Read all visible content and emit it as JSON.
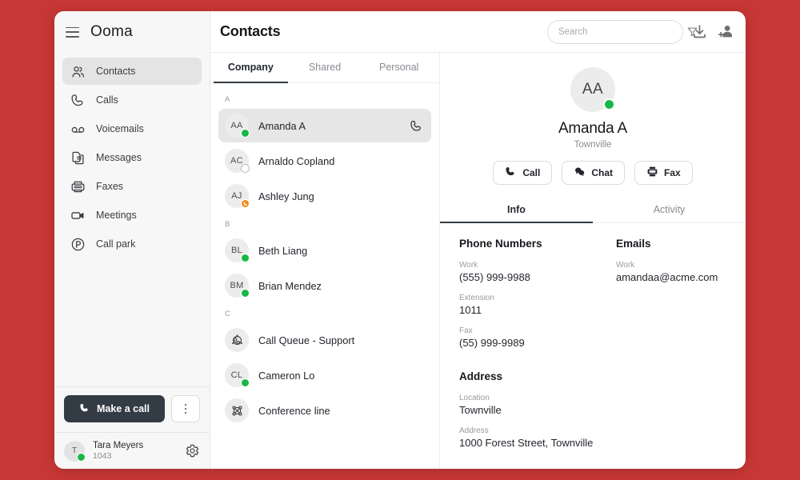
{
  "theme": {
    "desktop_bg": "#c73735",
    "accent_dark": "#333b44",
    "status_online": "#18b845",
    "status_oncall": "#f08a1e",
    "selected_bg": "#e6e6e6"
  },
  "sidebar": {
    "brand": "Ooma",
    "menu_icon": "hamburger-icon",
    "items": [
      {
        "label": "Contacts",
        "icon": "contacts-icon",
        "active": true
      },
      {
        "label": "Calls",
        "icon": "phone-icon",
        "active": false
      },
      {
        "label": "Voicemails",
        "icon": "voicemail-icon",
        "active": false
      },
      {
        "label": "Messages",
        "icon": "messages-icon",
        "active": false
      },
      {
        "label": "Faxes",
        "icon": "fax-icon",
        "active": false
      },
      {
        "label": "Meetings",
        "icon": "video-icon",
        "active": false
      },
      {
        "label": "Call park",
        "icon": "park-icon",
        "active": false
      }
    ],
    "make_call_label": "Make a call",
    "kebab_label": "More options",
    "user": {
      "initial": "T",
      "name": "Tara Meyers",
      "extension": "1043",
      "status": "online",
      "settings_icon": "gear-icon"
    }
  },
  "header": {
    "title": "Contacts",
    "search": {
      "placeholder": "Search",
      "value": ""
    },
    "filter_icon": "funnel-icon",
    "download_icon": "download-icon",
    "add_contact_icon": "add-contact-icon"
  },
  "list": {
    "tabs": [
      {
        "label": "Company",
        "active": true
      },
      {
        "label": "Shared",
        "active": false
      },
      {
        "label": "Personal",
        "active": false
      }
    ],
    "groups": [
      {
        "letter": "A",
        "contacts": [
          {
            "initials": "AA",
            "name": "Amanda A",
            "status": "online",
            "selected": true,
            "icon": null
          },
          {
            "initials": "AC",
            "name": "Arnaldo Copland",
            "status": "offline",
            "selected": false,
            "icon": null
          },
          {
            "initials": "AJ",
            "name": "Ashley Jung",
            "status": "oncall",
            "selected": false,
            "icon": null
          }
        ]
      },
      {
        "letter": "B",
        "contacts": [
          {
            "initials": "BL",
            "name": "Beth Liang",
            "status": "online",
            "selected": false,
            "icon": null
          },
          {
            "initials": "BM",
            "name": "Brian Mendez",
            "status": "online",
            "selected": false,
            "icon": null
          }
        ]
      },
      {
        "letter": "C",
        "contacts": [
          {
            "initials": "",
            "name": "Call Queue - Support",
            "status": "none",
            "selected": false,
            "icon": "call-queue-icon"
          },
          {
            "initials": "CL",
            "name": "Cameron Lo",
            "status": "online",
            "selected": false,
            "icon": null
          },
          {
            "initials": "",
            "name": "Conference line",
            "status": "none",
            "selected": false,
            "icon": "conference-icon"
          }
        ]
      }
    ]
  },
  "detail": {
    "initials": "AA",
    "name": "Amanda A",
    "subtitle": "Townville",
    "status": "online",
    "actions": [
      {
        "label": "Call",
        "icon": "phone-icon"
      },
      {
        "label": "Chat",
        "icon": "chat-icon"
      },
      {
        "label": "Fax",
        "icon": "fax-icon"
      }
    ],
    "tabs": [
      {
        "label": "Info",
        "active": true
      },
      {
        "label": "Activity",
        "active": false
      }
    ],
    "phone_section_title": "Phone Numbers",
    "phones": [
      {
        "label": "Work",
        "value": "(555) 999-9988"
      },
      {
        "label": "Extension",
        "value": "1011"
      },
      {
        "label": "Fax",
        "value": "(55) 999-9989"
      }
    ],
    "emails_section_title": "Emails",
    "emails": [
      {
        "label": "Work",
        "value": "amandaa@acme.com"
      }
    ],
    "address_section_title": "Address",
    "address": [
      {
        "label": "Location",
        "value": "Townville"
      },
      {
        "label": "Address",
        "value": "1000 Forest Street, Townville"
      }
    ]
  }
}
